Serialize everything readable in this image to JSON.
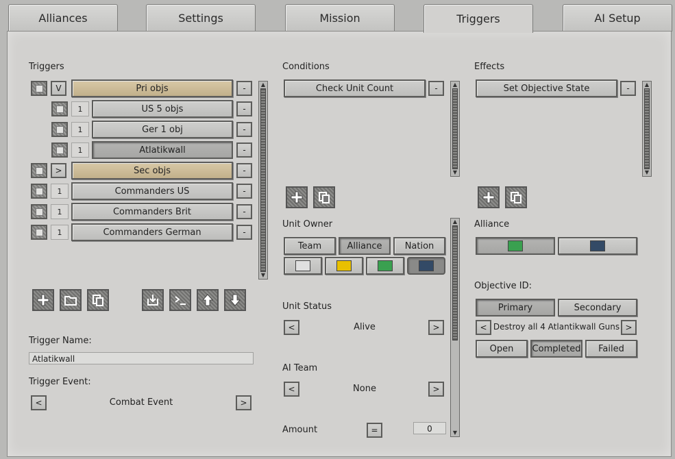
{
  "tabs": [
    "Alliances",
    "Settings",
    "Mission",
    "Triggers",
    "AI Setup"
  ],
  "triggers": {
    "section_label": "Triggers",
    "rows": [
      {
        "toggle": "V",
        "name": "Pri objs",
        "style": "tan",
        "indent": false
      },
      {
        "toggle": "1",
        "name": "US 5 objs",
        "style": "gray",
        "indent": true
      },
      {
        "toggle": "1",
        "name": "Ger 1 obj",
        "style": "gray",
        "indent": true
      },
      {
        "toggle": "1",
        "name": "Atlatikwall",
        "style": "pressed",
        "indent": true
      },
      {
        "toggle": ">",
        "name": "Sec objs",
        "style": "tan",
        "indent": false
      },
      {
        "toggle": "1",
        "name": "Commanders US",
        "style": "gray",
        "indent": false
      },
      {
        "toggle": "1",
        "name": "Commanders Brit",
        "style": "gray",
        "indent": false
      },
      {
        "toggle": "1",
        "name": "Commanders German",
        "style": "gray",
        "indent": false
      }
    ],
    "remove_label": "-",
    "name_label": "Trigger Name:",
    "name_value": "Atlatikwall",
    "event_label": "Trigger Event:",
    "event_value": "Combat Event",
    "prev": "<",
    "next": ">"
  },
  "conditions": {
    "section_label": "Conditions",
    "items": [
      "Check Unit Count"
    ],
    "remove_label": "-",
    "unit_owner_label": "Unit Owner",
    "owner_options": [
      "Team",
      "Alliance",
      "Nation"
    ],
    "owner_selected": "Alliance",
    "team_colors": [
      "#e0e0e0",
      "#e8c000",
      "#3aa050",
      "#334a66"
    ],
    "unit_status_label": "Unit Status",
    "unit_status_value": "Alive",
    "ai_team_label": "AI Team",
    "ai_team_value": "None",
    "amount_label": "Amount",
    "amount_op": "=",
    "amount_value": "0",
    "prev": "<",
    "next": ">"
  },
  "effects": {
    "section_label": "Effects",
    "items": [
      "Set Objective State"
    ],
    "remove_label": "-",
    "alliance_label": "Alliance",
    "alliance_colors": [
      "#3aa050",
      "#334a66"
    ],
    "objective_label": "Objective ID:",
    "objective_types": [
      "Primary",
      "Secondary"
    ],
    "objective_name": "Destroy all 4 Atlantikwall Guns",
    "states": [
      "Open",
      "Completed",
      "Failed"
    ],
    "state_selected": "Completed",
    "prev": "<",
    "next": ">"
  }
}
